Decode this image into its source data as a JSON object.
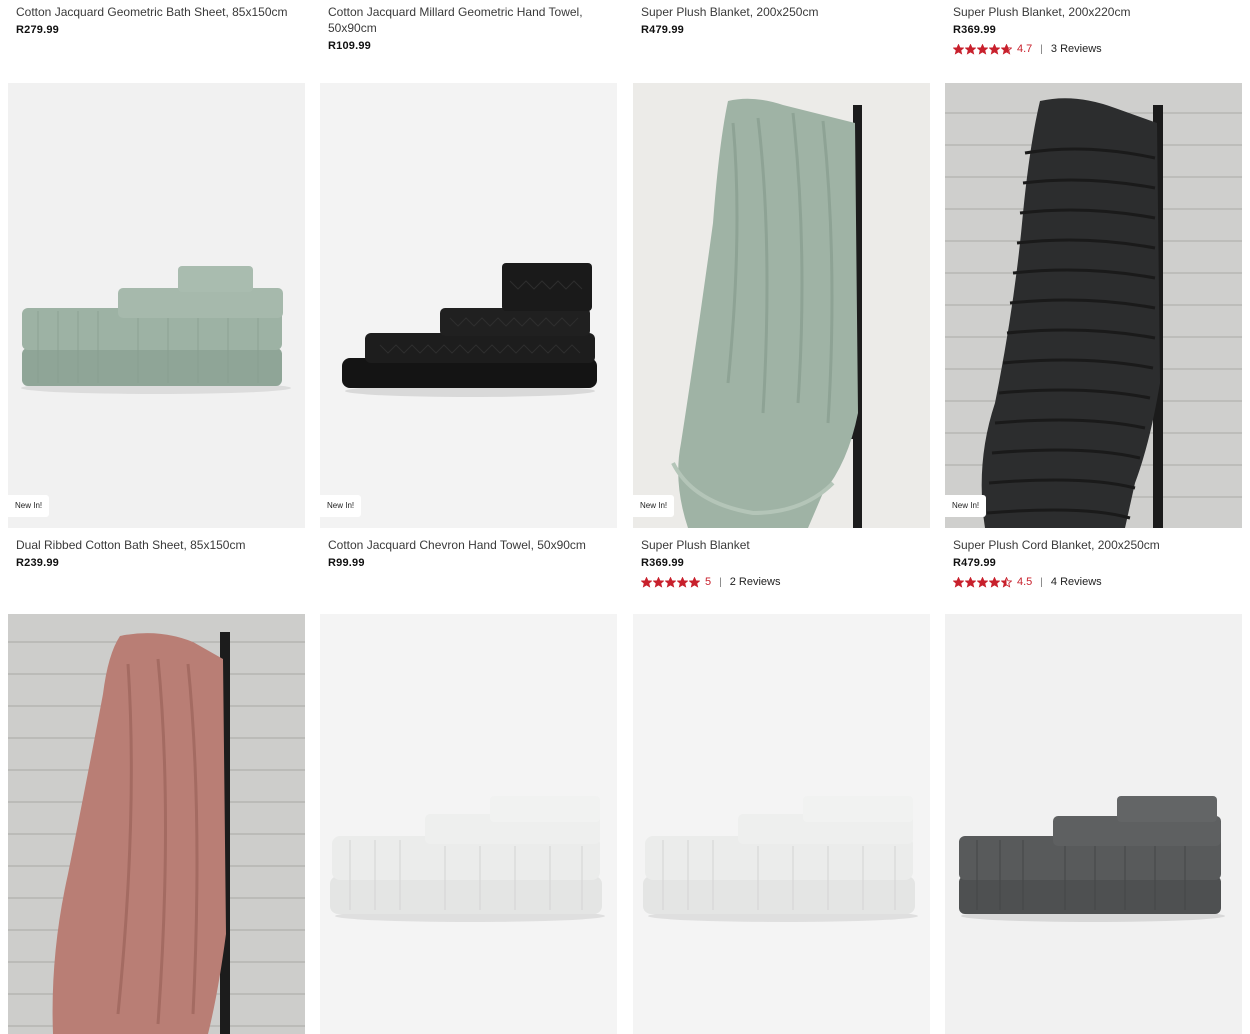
{
  "top_row": [
    {
      "title": "Cotton Jacquard Geometric Bath Sheet, 85x150cm",
      "price": "R279.99"
    },
    {
      "title": "Cotton Jacquard Millard Geometric Hand Towel, 50x90cm",
      "price": "R109.99"
    },
    {
      "title": "Super Plush Blanket, 200x250cm",
      "price": "R479.99"
    },
    {
      "title": "Super Plush Blanket, 200x220cm",
      "price": "R369.99",
      "rating": "4.7",
      "rating_stars": 4.7,
      "reviews": "3 Reviews"
    }
  ],
  "middle_row": [
    {
      "badge": "New In!",
      "title": "Dual Ribbed Cotton Bath Sheet, 85x150cm",
      "price": "R239.99",
      "image": "sage-towel-stack"
    },
    {
      "badge": "New In!",
      "title": "Cotton Jacquard Chevron Hand Towel, 50x90cm",
      "price": "R99.99",
      "image": "black-towel-stack"
    },
    {
      "badge": "New In!",
      "title": "Super Plush Blanket",
      "price": "R369.99",
      "rating": "5",
      "rating_stars": 5,
      "reviews": "2 Reviews",
      "image": "sage-blanket-on-ladder"
    },
    {
      "badge": "New In!",
      "title": "Super Plush Cord Blanket, 200x250cm",
      "price": "R479.99",
      "rating": "4.5",
      "rating_stars": 4.5,
      "reviews": "4 Reviews",
      "image": "charcoal-cord-blanket-on-ladder"
    }
  ],
  "bottom_row": [
    {
      "image": "pink-blanket-on-ladder"
    },
    {
      "image": "white-towel-stack"
    },
    {
      "image": "white-towel-stack"
    },
    {
      "image": "grey-towel-stack"
    }
  ],
  "colors": {
    "accent_star": "#c8202c",
    "sage": "#9fb3a5",
    "black": "#1b1b1b",
    "pink": "#b97e75",
    "white_towel": "#ebeceb",
    "grey_towel": "#585a5b"
  }
}
